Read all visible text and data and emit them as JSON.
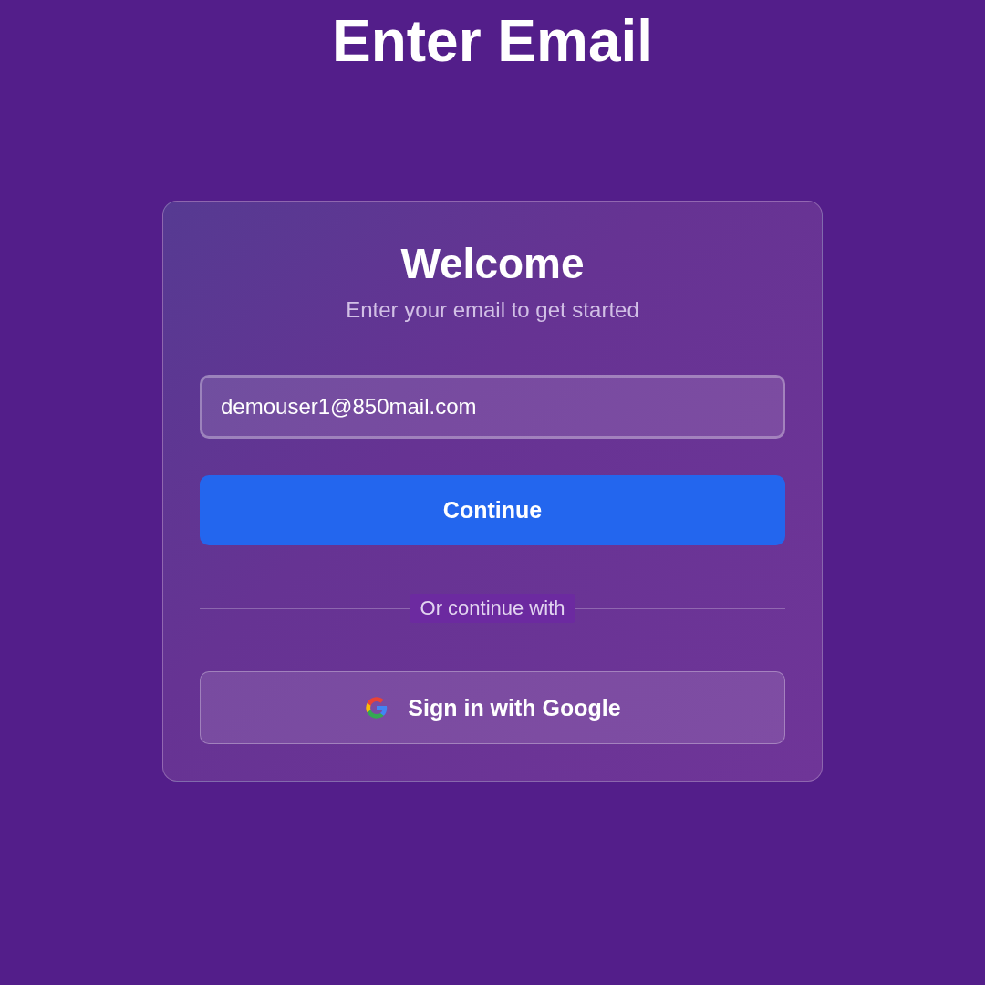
{
  "page_title": "Enter Email",
  "card": {
    "title": "Welcome",
    "subtitle": "Enter your email to get started",
    "email_field": {
      "value": "demouser1@850mail.com"
    },
    "continue_button": "Continue",
    "divider_text": "Or continue with",
    "google_button": "Sign in with Google"
  }
}
